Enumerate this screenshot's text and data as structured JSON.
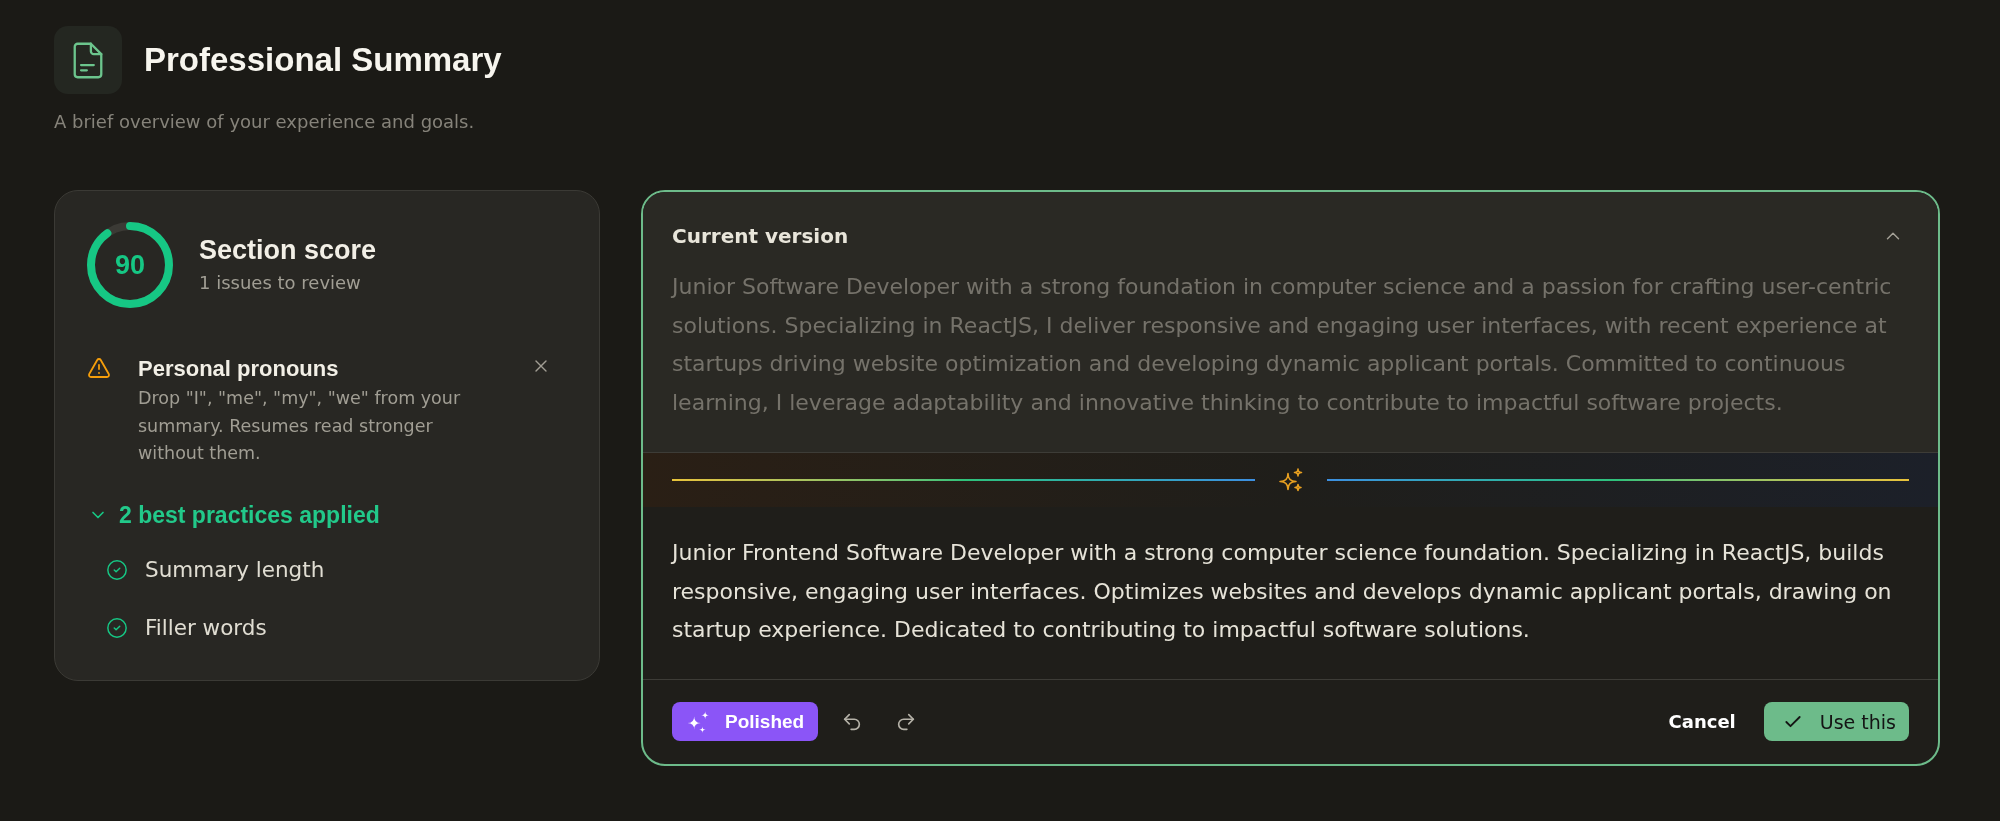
{
  "header": {
    "title": "Professional Summary",
    "subtitle": "A brief overview of your experience and goals."
  },
  "score_card": {
    "score": {
      "value": "90",
      "level": 0.9
    },
    "title": "Section score",
    "subtitle": "1 issues to review",
    "issues": [
      {
        "title": "Personal pronouns",
        "description": "Drop \"I\", \"me\", \"my\", \"we\" from your summary. Resumes read stronger without them."
      }
    ],
    "best_practices": {
      "label": "2 best practices applied",
      "expanded": true,
      "items": [
        {
          "label": "Summary length",
          "checked": true
        },
        {
          "label": "Filler words",
          "checked": true
        }
      ]
    }
  },
  "editor": {
    "current": {
      "title": "Current version",
      "expanded": true,
      "text": "Junior Software Developer with a strong foundation in computer science and a passion for crafting user-centric solutions. Specializing in ReactJS, I deliver responsive and engaging user interfaces, with recent experience at startups driving website optimization and developing dynamic applicant portals. Committed to continuous learning, I leverage adaptability and innovative thinking to contribute to impactful software projects."
    },
    "suggestion": {
      "text": "Junior Frontend Software Developer with a strong computer science foundation. Specializing in ReactJS, builds responsive, engaging user interfaces. Optimizes websites and develops dynamic applicant portals, drawing on startup experience. Dedicated to contributing to impactful software solutions."
    },
    "footer": {
      "mode": "Polished",
      "cancel": "Cancel",
      "apply": "Use this"
    }
  }
}
